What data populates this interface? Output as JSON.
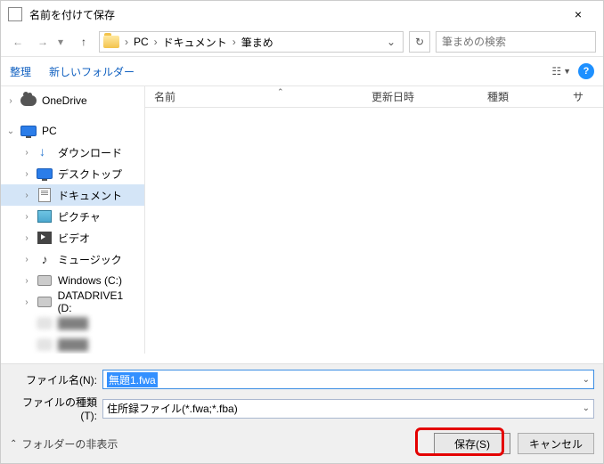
{
  "title": "名前を付けて保存",
  "path": {
    "seg1": "PC",
    "seg2": "ドキュメント",
    "seg3": "筆まめ"
  },
  "search": {
    "placeholder": "筆まめの検索"
  },
  "toolbar": {
    "organize": "整理",
    "newfolder": "新しいフォルダー"
  },
  "columns": {
    "name": "名前",
    "date": "更新日時",
    "type": "種類",
    "size": "サ"
  },
  "tree": {
    "onedrive": "OneDrive",
    "pc": "PC",
    "downloads": "ダウンロード",
    "desktop": "デスクトップ",
    "documents": "ドキュメント",
    "pictures": "ピクチャ",
    "videos": "ビデオ",
    "music": "ミュージック",
    "cdrive": "Windows (C:)",
    "ddrive": "DATADRIVE1 (D:"
  },
  "filename_label": "ファイル名(N):",
  "filetype_label": "ファイルの種類(T):",
  "filename_value": "無題1.fwa",
  "filetype_value": "住所録ファイル(*.fwa;*.fba)",
  "hide_folders": "フォルダーの非表示",
  "save_label": "保存(S)",
  "cancel_label": "キャンセル"
}
